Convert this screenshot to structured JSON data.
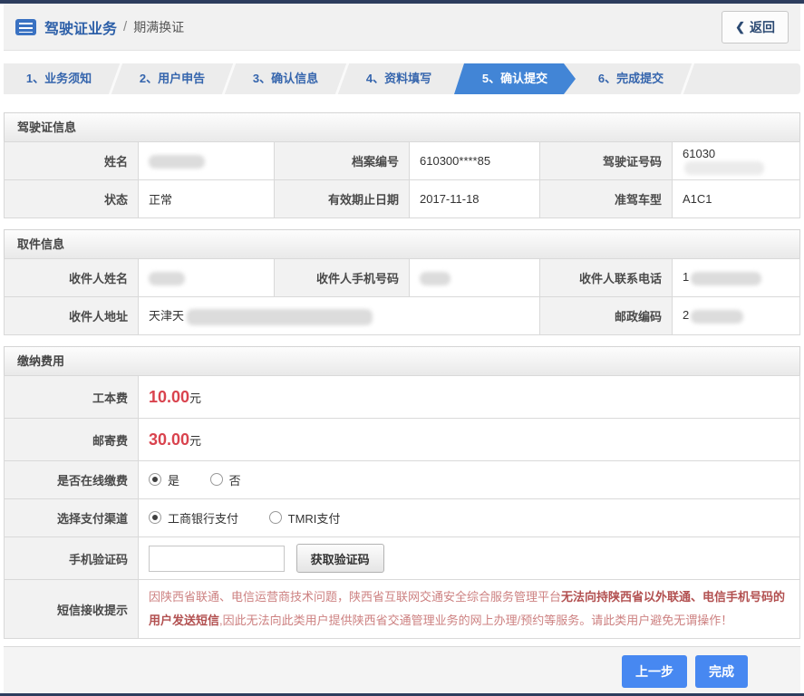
{
  "header": {
    "title": "驾驶证业务",
    "separator": "/",
    "subtitle": "期满换证",
    "back_chevron": "❮",
    "back_label": "返回"
  },
  "steps": [
    {
      "label": "1、业务须知",
      "active": false
    },
    {
      "label": "2、用户申告",
      "active": false
    },
    {
      "label": "3、确认信息",
      "active": false
    },
    {
      "label": "4、资料填写",
      "active": false
    },
    {
      "label": "5、确认提交",
      "active": true
    },
    {
      "label": "6、完成提交",
      "active": false
    }
  ],
  "license": {
    "title": "驾驶证信息",
    "name_label": "姓名",
    "file_no_label": "档案编号",
    "file_no_value": "610300****85",
    "license_no_label": "驾驶证号码",
    "license_no_value": "61030",
    "status_label": "状态",
    "status_value": "正常",
    "expiry_label": "有效期止日期",
    "expiry_value": "2017-11-18",
    "vehicle_label": "准驾车型",
    "vehicle_value": "A1C1"
  },
  "pickup": {
    "title": "取件信息",
    "recipient_name_label": "收件人姓名",
    "recipient_mobile_label": "收件人手机号码",
    "recipient_phone_label": "收件人联系电话",
    "recipient_phone_value": "1",
    "address_label": "收件人地址",
    "address_value": "天津天",
    "postcode_label": "邮政编码",
    "postcode_value": "2"
  },
  "fees": {
    "title": "缴纳费用",
    "work_fee_label": "工本费",
    "work_fee_value": "10.00",
    "mail_fee_label": "邮寄费",
    "mail_fee_value": "30.00",
    "unit": "元",
    "online_label": "是否在线缴费",
    "online_yes": "是",
    "online_no": "否",
    "channel_label": "选择支付渠道",
    "channel_icbc": "工商银行支付",
    "channel_tmri": "TMRI支付",
    "code_label": "手机验证码",
    "get_code_label": "获取验证码",
    "sms_label": "短信接收提示",
    "sms_part1": "因陕西省联通、电信运营商技术问题，陕西省互联网交通安全综合服务管理平台",
    "sms_part2": "无法向持陕西省以外联通、电信手机号码的用户发送短信",
    "sms_part3": ",因此无法向此类用户提供陕西省交通管理业务的网上办理/预约等服务。请此类用户避免无谓操作！"
  },
  "footer": {
    "prev_label": "上一步",
    "finish_label": "完成"
  },
  "colors": {
    "accent_blue": "#4285d6",
    "navy_bar": "#2d3d5e",
    "price_red": "#d9434e"
  }
}
